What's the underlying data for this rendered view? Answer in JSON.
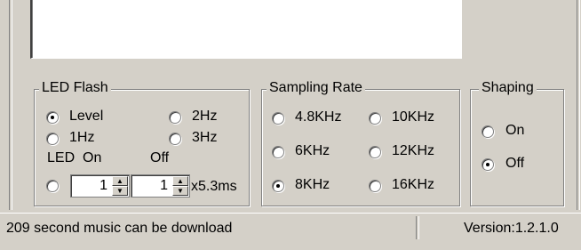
{
  "led_flash": {
    "title": "LED Flash",
    "level": "Level",
    "hz2": "2Hz",
    "hz1": "1Hz",
    "hz3": "3Hz",
    "led_on_label": "LED  On",
    "off_label": "Off",
    "on_value": "1",
    "off_value": "1",
    "unit": "x5.3ms",
    "selected": "Level"
  },
  "sampling_rate": {
    "title": "Sampling Rate",
    "r48": "4.8KHz",
    "r10": "10KHz",
    "r6": "6KHz",
    "r12": "12KHz",
    "r8": "8KHz",
    "r16": "16KHz",
    "selected": "8KHz"
  },
  "shaping": {
    "title": "Shaping",
    "on": "On",
    "off": "Off",
    "selected": "Off"
  },
  "status_bar": {
    "message": "209 second music can be download",
    "version": "Version:1.2.1.0"
  }
}
